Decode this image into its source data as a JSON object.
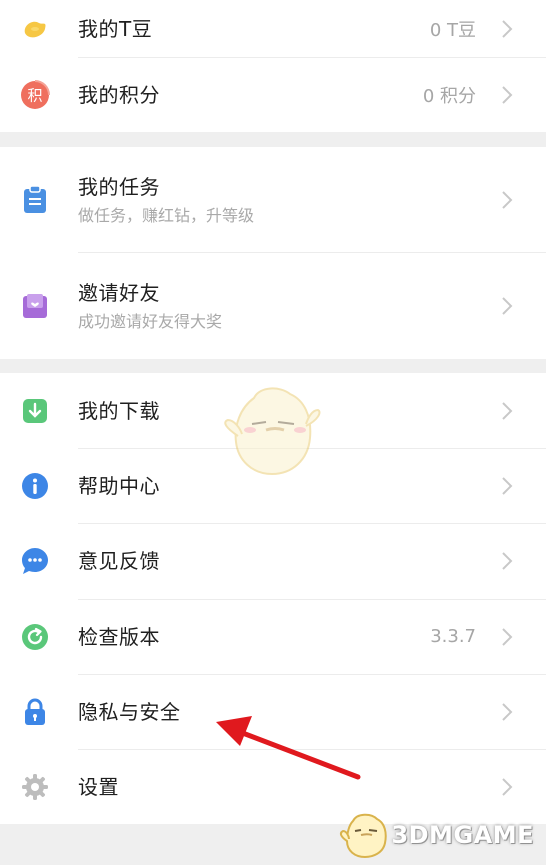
{
  "group1": {
    "items": [
      {
        "label": "我的T豆",
        "value": "0 T豆",
        "icon": "bean-icon"
      },
      {
        "label": "我的积分",
        "value": "0 积分",
        "icon": "points-icon",
        "icon_text": "积"
      }
    ]
  },
  "group2": {
    "items": [
      {
        "label": "我的任务",
        "sub": "做任务，赚红钻，升等级",
        "icon": "clipboard-icon"
      },
      {
        "label": "邀请好友",
        "sub": "成功邀请好友得大奖",
        "icon": "invite-envelope-icon"
      }
    ]
  },
  "group3": {
    "items": [
      {
        "label": "我的下载",
        "icon": "download-icon"
      },
      {
        "label": "帮助中心",
        "icon": "info-icon"
      },
      {
        "label": "意见反馈",
        "icon": "feedback-chat-icon"
      },
      {
        "label": "检查版本",
        "value": "3.3.7",
        "icon": "refresh-icon"
      },
      {
        "label": "隐私与安全",
        "icon": "lock-icon"
      },
      {
        "label": "设置",
        "icon": "gear-icon"
      }
    ]
  },
  "watermark": {
    "brand": "3DMGAME"
  },
  "colors": {
    "bean": "#f6c744",
    "points": "#ef6f5e",
    "task": "#4a90e2",
    "invite": "#a66bd8",
    "download": "#5ac77a",
    "info": "#3d86e6",
    "feedback": "#3d86e6",
    "refresh": "#5ac77a",
    "lock": "#3d86e6",
    "gear": "#bdbdbd",
    "annotation_arrow": "#e0191e"
  }
}
